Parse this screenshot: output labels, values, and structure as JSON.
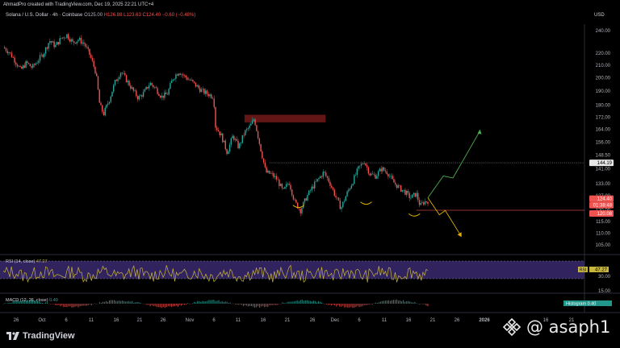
{
  "header": {
    "author_line": "AhmadPro created with TradingView.com, Dec 19, 2025 22:21 UTC+4",
    "symbol": "Solana / U.S. Dollar · 4h · Coinbase",
    "ohlc_o": "O125.00",
    "ohlc_h": "H126.88",
    "ohlc_l": "L123.63",
    "ohlc_c": "C124.40",
    "change": "−0.60 (−0.48%)",
    "currency": "USD"
  },
  "price_axis": {
    "ticks": [
      "240.00",
      "220.00",
      "210.00",
      "200.00",
      "190.00",
      "180.00",
      "172.00",
      "164.00",
      "156.00",
      "148.50",
      "141.00",
      "133.00",
      "127.00",
      "120.00",
      "115.00",
      "110.00",
      "105.00"
    ],
    "level_label": "144.19",
    "last_price_label": "124.40",
    "countdown_label": "01:38:48",
    "low_label": "120.08"
  },
  "rsi": {
    "label": "RSI (14, close)",
    "value": "47.27",
    "axis_tag": "RSI",
    "axis_value": "47.27",
    "tick_30": "30.00",
    "tick_15": "15.00"
  },
  "macd": {
    "label": "MACD (12, 26, close)",
    "value": "0.40",
    "axis_tag": "Histogram",
    "axis_value": "0.40"
  },
  "time_axis": {
    "labels": [
      "26",
      "Oct",
      "6",
      "11",
      "16",
      "21",
      "26",
      "Nov",
      "6",
      "11",
      "16",
      "21",
      "26",
      "Dec",
      "6",
      "11",
      "16",
      "21",
      "26",
      "2026",
      "16",
      "21"
    ]
  },
  "footer": {
    "brand": "TradingView",
    "watermark": "@ asaph1"
  },
  "colors": {
    "up": "#26a69a",
    "down": "#ef5350",
    "rsi_line": "#c9b63d",
    "rsi_band": "#3a2a6e",
    "supply_zone": "#8c1f1f",
    "projection_up": "#4caf50",
    "projection_down": "#e0b000",
    "support_arc": "#e0b000"
  },
  "chart_data": {
    "type": "candlestick",
    "interval": "4h",
    "ylim": [
      102,
      248
    ],
    "y_scale": "log",
    "series": [
      {
        "name": "Solana / U.S. Dollar",
        "path_close": [
          [
            0,
            225
          ],
          [
            3,
            221
          ],
          [
            6,
            214
          ],
          [
            9,
            206
          ],
          [
            12,
            212
          ],
          [
            15,
            208
          ],
          [
            18,
            214
          ],
          [
            21,
            220
          ],
          [
            24,
            231
          ],
          [
            27,
            226
          ],
          [
            30,
            233
          ],
          [
            33,
            236
          ],
          [
            36,
            229
          ],
          [
            39,
            232
          ],
          [
            42,
            228
          ],
          [
            45,
            218
          ],
          [
            48,
            204
          ],
          [
            50,
            180
          ],
          [
            52,
            174
          ],
          [
            55,
            184
          ],
          [
            58,
            197
          ],
          [
            61,
            205
          ],
          [
            64,
            198
          ],
          [
            67,
            191
          ],
          [
            70,
            185
          ],
          [
            73,
            189
          ],
          [
            76,
            196
          ],
          [
            79,
            192
          ],
          [
            82,
            186
          ],
          [
            85,
            188
          ],
          [
            88,
            200
          ],
          [
            91,
            205
          ],
          [
            94,
            201
          ],
          [
            97,
            198
          ],
          [
            100,
            194
          ],
          [
            103,
            190
          ],
          [
            106,
            188
          ],
          [
            109,
            186
          ],
          [
            110,
            166
          ],
          [
            113,
            160
          ],
          [
            116,
            150
          ],
          [
            119,
            160
          ],
          [
            122,
            153
          ],
          [
            125,
            162
          ],
          [
            128,
            166
          ],
          [
            130,
            171
          ],
          [
            133,
            154
          ],
          [
            136,
            139
          ],
          [
            139,
            138
          ],
          [
            142,
            135
          ],
          [
            145,
            129
          ],
          [
            148,
            134
          ],
          [
            151,
            124
          ],
          [
            154,
            120
          ],
          [
            157,
            126
          ],
          [
            160,
            131
          ],
          [
            163,
            135
          ],
          [
            166,
            139
          ],
          [
            169,
            134
          ],
          [
            172,
            127
          ],
          [
            175,
            121
          ],
          [
            178,
            128
          ],
          [
            181,
            134
          ],
          [
            184,
            141
          ],
          [
            187,
            145
          ],
          [
            190,
            138
          ],
          [
            193,
            137
          ],
          [
            196,
            141
          ],
          [
            199,
            139
          ],
          [
            202,
            134
          ],
          [
            205,
            131
          ],
          [
            208,
            129
          ],
          [
            211,
            126
          ],
          [
            214,
            128
          ],
          [
            216,
            122
          ],
          [
            218,
            124
          ],
          [
            220,
            124.4
          ]
        ]
      }
    ],
    "annotations": {
      "horizontal_level": 144.19,
      "supply_zone": [
        168.5,
        173.5
      ],
      "support_low": 120.08,
      "projection_up_to": 163,
      "projection_down_to": 109
    },
    "rsi_value": 47.27,
    "macd_histogram": 0.4
  }
}
